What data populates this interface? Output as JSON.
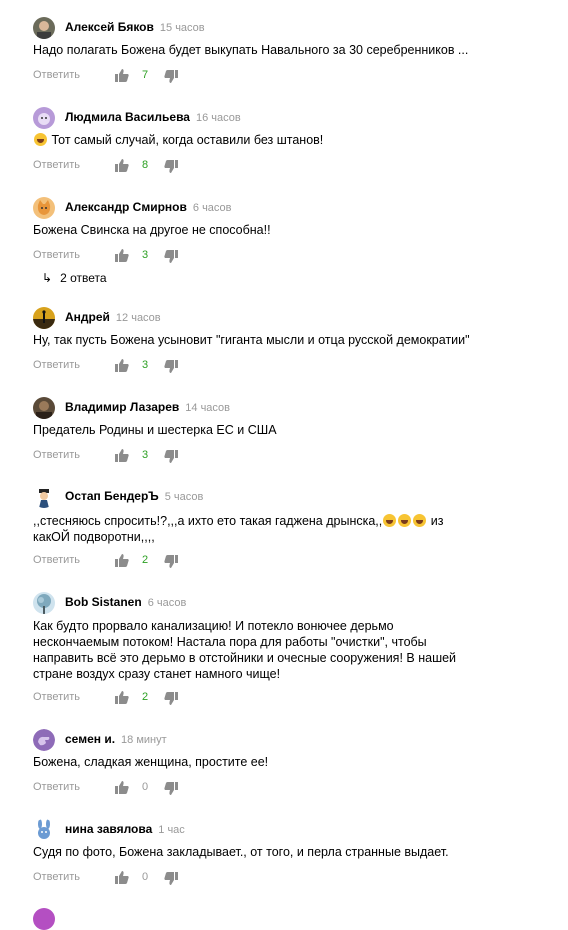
{
  "labels": {
    "reply": "Ответить"
  },
  "replies_link": {
    "arrow": "↳",
    "label": "2 ответа"
  },
  "colors": {
    "like_positive": "#2ca023",
    "muted": "#999999",
    "icon": "#8c8c8c"
  },
  "comments": [
    {
      "author": "Алексей Бяков",
      "time": "15 часов",
      "text": "Надо полагать Божена будет выкупать Навального за 30 серебренников ...",
      "likes": "7",
      "avatar": "photo-man-icon"
    },
    {
      "author": "Людмила Васильева",
      "time": "16 часов",
      "text": "Тот самый случай, когда оставили без штанов!",
      "likes": "8",
      "avatar": "cartoon-purple-icon",
      "emoji": "laughing-emoji"
    },
    {
      "author": "Александр Смирнов",
      "time": "6 часов",
      "text": "Божена Свинска на другое не способна!!",
      "likes": "3",
      "avatar": "cat-icon"
    },
    {
      "author": "Андрей",
      "time": "12 часов",
      "text": "Ну, так пусть Божена усыновит \"гиганта мысли и отца русской демократии\"",
      "likes": "3",
      "avatar": "sunset-icon"
    },
    {
      "author": "Владимир Лазарев",
      "time": "14 часов",
      "text": "Предатель Родины и шестерка ЕС и США",
      "likes": "3",
      "avatar": "photo-dark-icon"
    },
    {
      "author": "Остап БендерЪ",
      "time": "5 часов",
      "text": ",,стесняюсь спросить!?,,,а ихто ето такая гаджена дрынска,,",
      "text2": " из какОЙ подворотни,,,,",
      "likes": "2",
      "avatar": "cartoon-man-icon",
      "emoji": "laughing-emoji"
    },
    {
      "author": "Bob Sistanen",
      "time": "6 часов",
      "text": "Как будто прорвало канализацию! И потекло вонючее дерьмо нескончаемым потоком! Настала пора для работы \"очистки\", чтобы направить всё это дерьмо в отстойники и очесные сооружения! В нашей стране воздух сразу станет намного чище!",
      "likes": "2",
      "avatar": "tree-icon"
    },
    {
      "author": "семен и.",
      "time": "18 минут",
      "text": "Божена, сладкая женщина, простите ее!",
      "likes": "0",
      "avatar": "hand-icon"
    },
    {
      "author": "нина завялова",
      "time": "1 час",
      "text": "Судя по фото, Божена закладывает., от того, и перла странные выдает.",
      "likes": "0",
      "avatar": "bunny-icon"
    }
  ]
}
